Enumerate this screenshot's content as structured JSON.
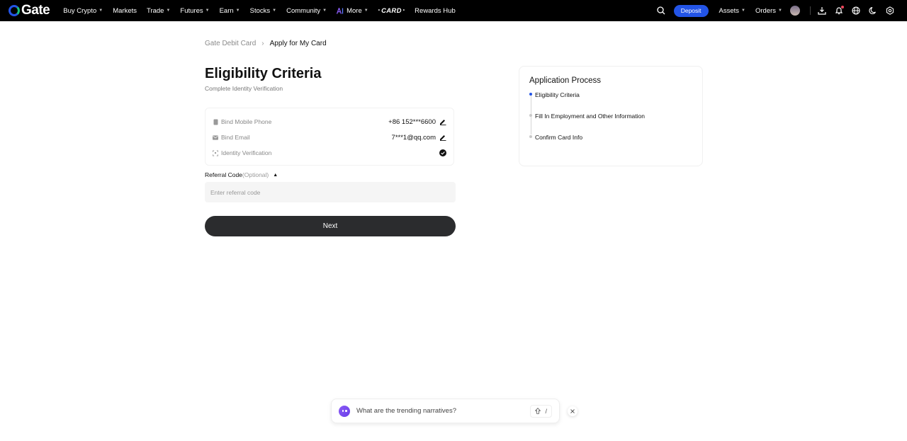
{
  "header": {
    "logo_text": "Gate",
    "nav": [
      {
        "label": "Buy Crypto",
        "dropdown": true
      },
      {
        "label": "Markets",
        "dropdown": false
      },
      {
        "label": "Trade",
        "dropdown": true
      },
      {
        "label": "Futures",
        "dropdown": true
      },
      {
        "label": "Earn",
        "dropdown": true
      },
      {
        "label": "Stocks",
        "dropdown": true
      },
      {
        "label": "Community",
        "dropdown": true
      }
    ],
    "more_label": "More",
    "card_label": "CARD",
    "rewards_label": "Rewards Hub",
    "deposit_label": "Deposit",
    "assets_label": "Assets",
    "orders_label": "Orders",
    "accent_color": "#2354e6"
  },
  "breadcrumb": {
    "parent": "Gate Debit Card",
    "current": "Apply for My Card"
  },
  "main": {
    "title": "Eligibility Criteria",
    "subtitle": "Complete Identity Verification",
    "verifications": {
      "phone_label": "Bind Mobile Phone",
      "phone_value": "+86 152***6600",
      "email_label": "Bind Email",
      "email_value": "7***1@qq.com",
      "identity_label": "Identity Verification"
    },
    "referral": {
      "label": "Referral Code",
      "optional": "(Optional)",
      "placeholder": "Enter referral code",
      "value": ""
    },
    "next_label": "Next"
  },
  "process": {
    "title": "Application Process",
    "steps": [
      {
        "label": "Eligibility Criteria",
        "active": true
      },
      {
        "label": "Fill In Employment and Other Information",
        "active": false
      },
      {
        "label": "Confirm Card Info",
        "active": false
      }
    ]
  },
  "ai_bar": {
    "prompt": "What are the trending narratives?",
    "shortcut": "/"
  }
}
